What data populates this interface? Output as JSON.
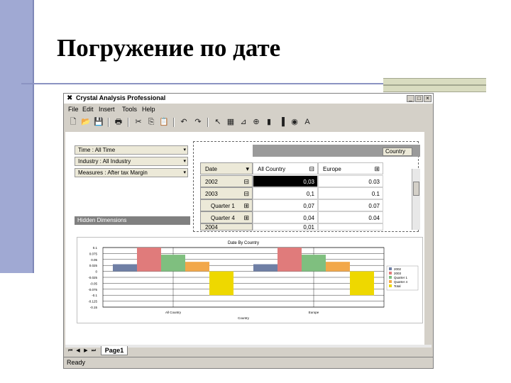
{
  "slide": {
    "title": "Погружение по дате"
  },
  "window": {
    "title": "Crystal Analysis Professional",
    "min_glyph": "_",
    "max_glyph": "□",
    "close_glyph": "×"
  },
  "menu": [
    "File",
    "Edit",
    "Insert",
    "Tools",
    "Help"
  ],
  "dimensions": [
    {
      "label": "Time : All Time"
    },
    {
      "label": "Industry : All Industry"
    },
    {
      "label": "Measures : After tax Margin"
    }
  ],
  "hidden_dimensions_label": "Hidden Dimensions",
  "grid": {
    "country_button": "Country",
    "row_dim_label": "Date",
    "col_headers": [
      "All Country",
      "Europe"
    ],
    "rows": [
      {
        "label": "2002",
        "values": [
          "0,03",
          "0.03"
        ]
      },
      {
        "label": "2003",
        "values": [
          "0,1",
          "0.1"
        ]
      },
      {
        "label": "Quarter 1",
        "values": [
          "0,07",
          "0.07"
        ]
      },
      {
        "label": "Quarter 4",
        "values": [
          "0,04",
          "0.04"
        ]
      },
      {
        "label": "2004",
        "values": [
          "0,01",
          ""
        ]
      }
    ]
  },
  "chart_data": {
    "type": "bar",
    "title": "Date By Country",
    "xlabel": "Country",
    "ylabel": "",
    "categories": [
      "All Country",
      "Europe"
    ],
    "ylim": [
      -0.15,
      0.1
    ],
    "y_ticks": [
      "0.1",
      "0.075",
      "0.05",
      "0.025",
      "0",
      "-0.025",
      "-0.05",
      "-0.075",
      "-0.1",
      "-0.125",
      "-0.15"
    ],
    "grid": true,
    "legend_position": "right",
    "series": [
      {
        "name": "2002",
        "color": "#6f7fa5",
        "values": [
          0.03,
          0.03
        ]
      },
      {
        "name": "2003",
        "color": "#e07b7b",
        "values": [
          0.1,
          0.1
        ]
      },
      {
        "name": "Quarter 1",
        "color": "#7fbf7f",
        "values": [
          0.07,
          0.07
        ]
      },
      {
        "name": "Quarter 4",
        "color": "#f2a84a",
        "values": [
          0.04,
          0.04
        ]
      },
      {
        "name": "Total",
        "color": "#eed800",
        "values": [
          -0.1,
          -0.1
        ]
      }
    ]
  },
  "sheet_tab": "Page1",
  "status": "Ready"
}
